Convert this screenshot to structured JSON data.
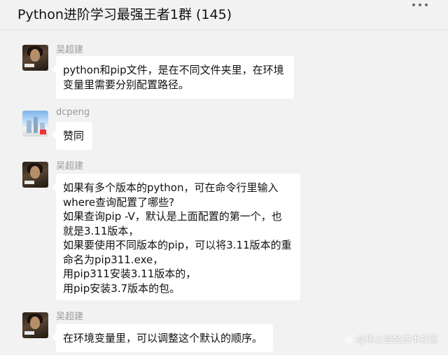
{
  "header": {
    "title": "Python进阶学习最强王者1群 (145)"
  },
  "messages": [
    {
      "sender": "吴超建",
      "avatar": "portrait-avatar",
      "text": "python和pip文件，是在不同文件夹里，在环境\n变量里需要分别配置路径。"
    },
    {
      "sender": "dcpeng",
      "avatar": "city-avatar",
      "text": "赞同"
    },
    {
      "sender": "吴超建",
      "avatar": "portrait-avatar",
      "text": "如果有多个版本的python，可在命令行里输入\nwhere查询配置了哪些?\n如果查询pip -V，默认是上面配置的第一个，也\n就是3.11版本，\n如果要使用不同版本的pip，可以将3.11版本的重\n命名为pip311.exe，\n用pip311安装3.11版本的，\n用pip安装3.7版本的包。"
    },
    {
      "sender": "吴超建",
      "avatar": "portrait-avatar",
      "text": "在环境变量里，可以调整这个默认的顺序。"
    }
  ],
  "watermark": "@稀土掘金技术社区",
  "colors": {
    "background": "#f2f2f2",
    "bubble": "#ffffff",
    "sender": "#9a9a9a"
  }
}
